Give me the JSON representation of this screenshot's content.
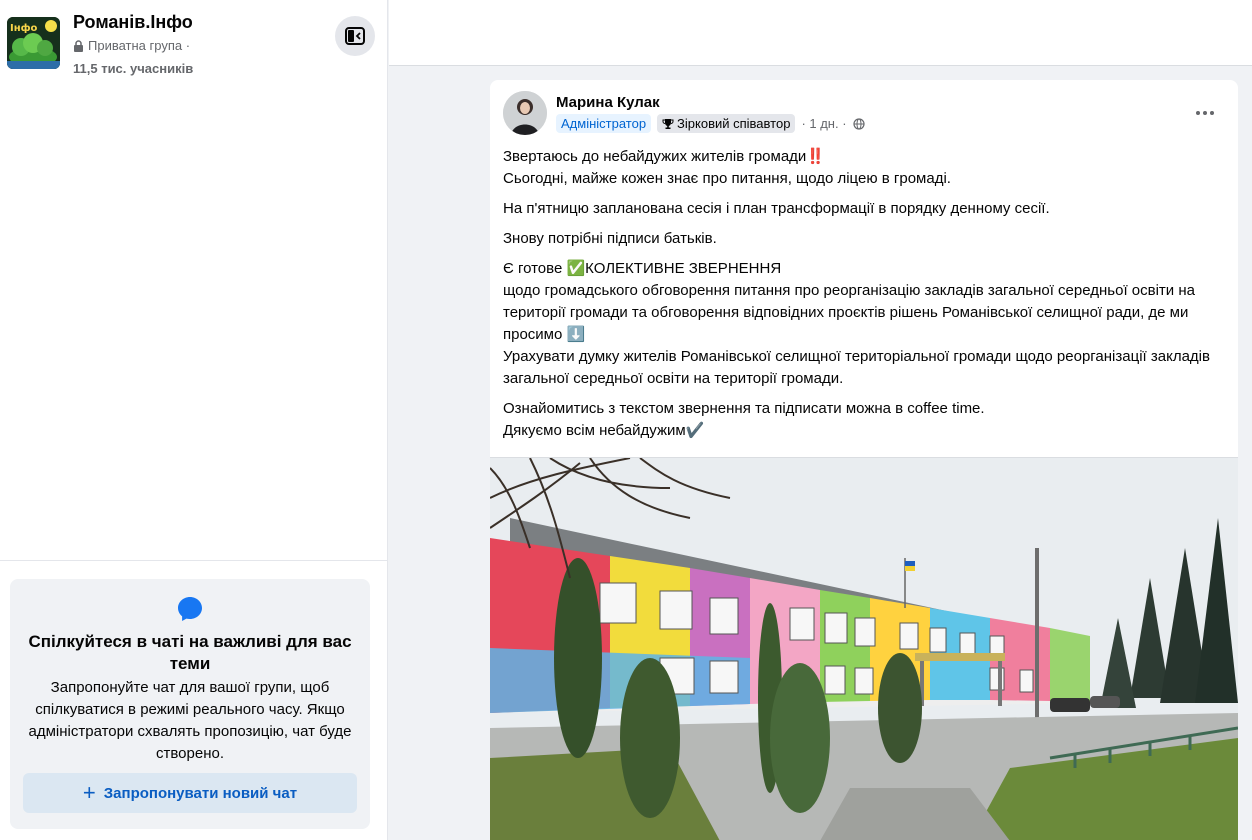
{
  "group": {
    "name": "Романів.Інфо",
    "privacy": "Приватна група ·",
    "members": "11,5 тис. учасників",
    "avatar_text": "Інфо"
  },
  "chat_card": {
    "title": "Спілкуйтеся в чаті на важливі для вас теми",
    "description": "Запропонуйте чат для вашої групи, щоб спілкуватися в режимі реального часу. Якщо адміністратори схвалять пропозицію, чат буде створено.",
    "button_label": "Запропонувати новий чат",
    "button_icon": "+"
  },
  "post": {
    "author": "Марина Кулак",
    "badge_admin": "Адміністратор",
    "badge_star": "Зірковий співавтор",
    "time": "· 1 дн. ·",
    "paragraphs": [
      {
        "lines": [
          "Звертаюсь до небайдужих жителів громади‼️",
          "Сьогодні, майже кожен знає про питання, щодо ліцею в громаді."
        ]
      },
      {
        "lines": [
          "На п'ятницю запланована сесія і план трансформації в порядку денному сесії."
        ]
      },
      {
        "lines": [
          "Знову потрібні підписи батьків."
        ]
      },
      {
        "lines": [
          "Є готове ✅КОЛЕКТИВНЕ ЗВЕРНЕННЯ",
          "щодо громадського обговорення питання про реорганізацію закладів загальної середньої освіти на території громади та обговорення відповідних проєктів рішень Романівської селищної ради, де ми просимо ⬇️",
          "Урахувати думку жителів Романівської селищної територіальної громади щодо реорганізації закладів загальної середньої освіти на території громади."
        ]
      },
      {
        "lines": [
          "Ознайомитись з текстом звернення та підписати можна в coffee time.",
          "Дякуємо всім небайдужим✔️"
        ]
      }
    ]
  },
  "icons": {
    "lock": "lock-icon",
    "sidebar_toggle": "sidebar-collapse-icon",
    "chat": "messenger-icon",
    "trophy": "trophy-icon",
    "globe": "globe-icon",
    "more": "more-horizontal-icon"
  },
  "colors": {
    "accent": "#0064d1",
    "admin_badge_bg": "#e7f3ff",
    "chat_btn_bg": "#dbe7f2",
    "page_bg": "#f0f2f5"
  }
}
